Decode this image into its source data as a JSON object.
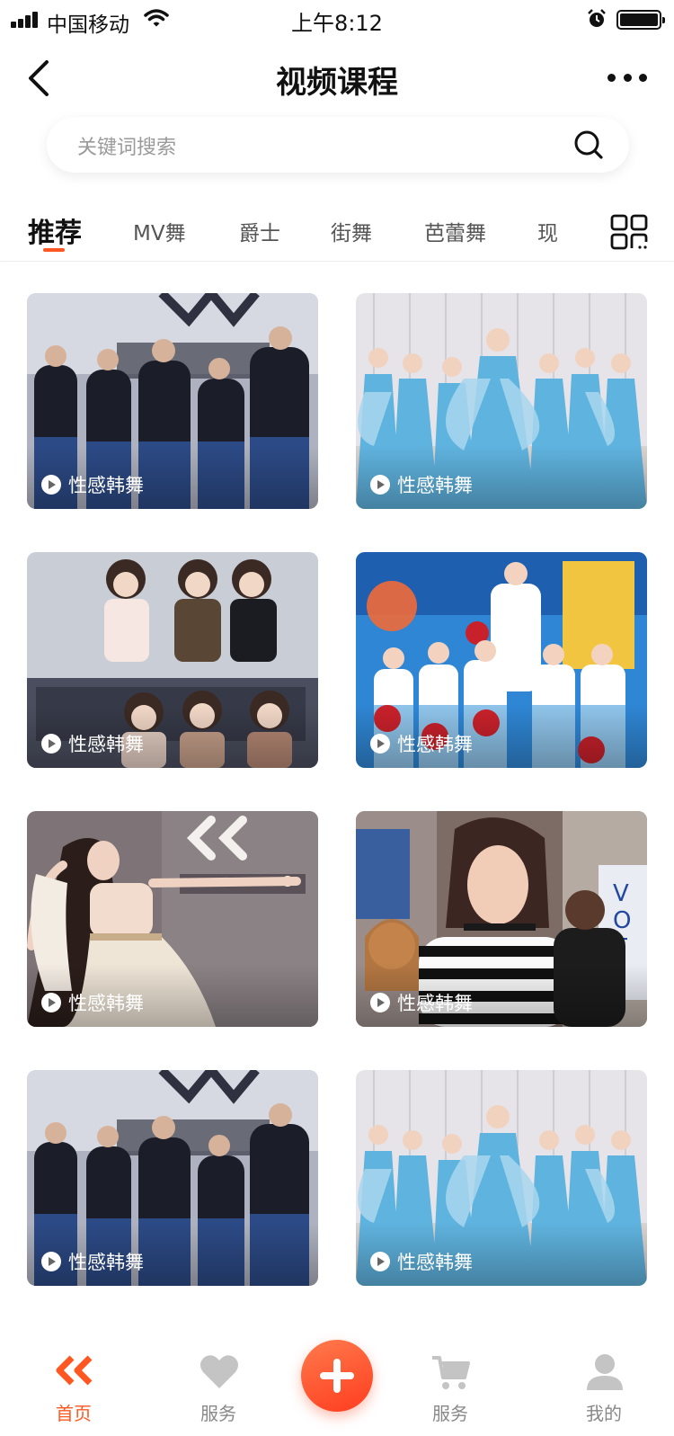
{
  "status_bar": {
    "carrier": "中国移动",
    "time": "上午8:12"
  },
  "header": {
    "title": "视频课程"
  },
  "search": {
    "placeholder": "关键词搜索"
  },
  "tabs": [
    {
      "label": "推荐",
      "active": true
    },
    {
      "label": "MV舞",
      "active": false
    },
    {
      "label": "爵士",
      "active": false
    },
    {
      "label": "街舞",
      "active": false
    },
    {
      "label": "芭蕾舞",
      "active": false
    },
    {
      "label": "现",
      "active": false
    }
  ],
  "videos": [
    {
      "title": "性感韩舞"
    },
    {
      "title": "性感韩舞"
    },
    {
      "title": "性感韩舞"
    },
    {
      "title": "性感韩舞"
    },
    {
      "title": "性感韩舞"
    },
    {
      "title": "性感韩舞"
    },
    {
      "title": "性感韩舞"
    },
    {
      "title": "性感韩舞"
    }
  ],
  "tabbar": [
    {
      "label": "首页",
      "icon": "brand-logo-icon",
      "active": true
    },
    {
      "label": "服务",
      "icon": "heart-icon",
      "active": false
    },
    {
      "label": "",
      "icon": "plus-icon",
      "active": false
    },
    {
      "label": "服务",
      "icon": "cart-icon",
      "active": false
    },
    {
      "label": "我的",
      "icon": "person-icon",
      "active": false
    }
  ],
  "colors": {
    "accent": "#ff5722",
    "inactive": "#888888"
  }
}
